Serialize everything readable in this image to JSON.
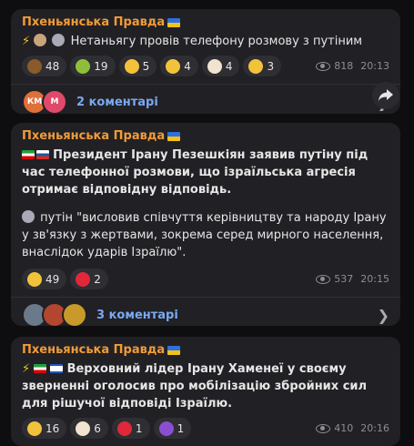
{
  "posts": [
    {
      "channel": "Пхеньянська Правда",
      "lines": [
        "Нетаньягу провів телефону розмову з путіним"
      ],
      "reactions": [
        {
          "icon": "poop-emoji",
          "count": "48",
          "color": "#8a5a2b"
        },
        {
          "icon": "nauseated-face-emoji",
          "count": "19",
          "color": "#8fbf3a"
        },
        {
          "icon": "thumbs-down-emoji",
          "count": "5",
          "color": "#f3c23b"
        },
        {
          "icon": "grinning-face-emoji",
          "count": "4",
          "color": "#f3c23b"
        },
        {
          "icon": "clown-face-emoji",
          "count": "4",
          "color": "#f0e3d0"
        },
        {
          "icon": "rofl-emoji",
          "count": "3",
          "color": "#f3c23b"
        }
      ],
      "views": "818",
      "time": "20:13",
      "comments_label": "2 коментарі",
      "avatars": [
        {
          "text": "КМ",
          "color": "#e0703a"
        },
        {
          "text": "M",
          "color": "#e04a6a"
        }
      ]
    },
    {
      "channel": "Пхеньянська Правда",
      "headline": "Президент Ірану Пезешкіян заявив путіну під час телефонної розмови, що ізраїльська агресія отримає відповідну відповідь.",
      "quote": "путін \"висловив співчуття керівництву та народу Ірану у зв'язку з жертвами, зокрема серед мирного населення, внаслідок ударів Ізраїлю\".",
      "reactions": [
        {
          "icon": "rofl-emoji",
          "count": "49",
          "color": "#f3c23b"
        },
        {
          "icon": "heart-emoji",
          "count": "2",
          "color": "#e0283a"
        }
      ],
      "views": "537",
      "time": "20:15",
      "comments_label": "3 коментарі",
      "avatars": [
        {
          "text": "",
          "color": "#6b7a8a"
        },
        {
          "text": "",
          "color": "#b3462e"
        },
        {
          "text": "",
          "color": "#c99a2a"
        }
      ]
    },
    {
      "channel": "Пхеньянська Правда",
      "headline": "Верховний лідер Ірану Хаменеї у своєму зверненні оголосив про мобілізацію збройних сил для рішучої відповіді Ізраїлю.",
      "reactions": [
        {
          "icon": "rofl-emoji",
          "count": "16",
          "color": "#f3c23b"
        },
        {
          "icon": "clown-face-emoji",
          "count": "6",
          "color": "#f0e3d0"
        },
        {
          "icon": "hundred-points-emoji",
          "count": "1",
          "color": "#e0283a"
        },
        {
          "icon": "smiling-devil-emoji",
          "count": "1",
          "color": "#8a4fd0"
        }
      ],
      "views": "410",
      "time": "20:16"
    }
  ]
}
